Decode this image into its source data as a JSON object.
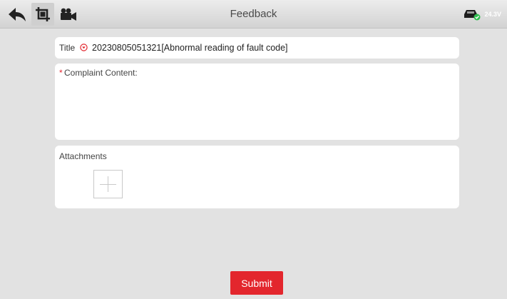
{
  "header": {
    "title": "Feedback",
    "icons": [
      "back-arrow-icon",
      "screenshot-icon",
      "video-record-icon",
      "vehicle-battery-icon"
    ],
    "voltage": "24.3V"
  },
  "form": {
    "title_label": "Title",
    "title_value": "20230805051321[Abnormal reading of fault code]",
    "complaint_required_mark": "*",
    "complaint_label": "Complaint Content:",
    "complaint_value": "",
    "attachments_label": "Attachments"
  },
  "actions": {
    "submit_label": "Submit"
  },
  "colors": {
    "accent": "#e3262d",
    "battery_ok": "#2fbf4f",
    "background": "#e2e2e2"
  }
}
